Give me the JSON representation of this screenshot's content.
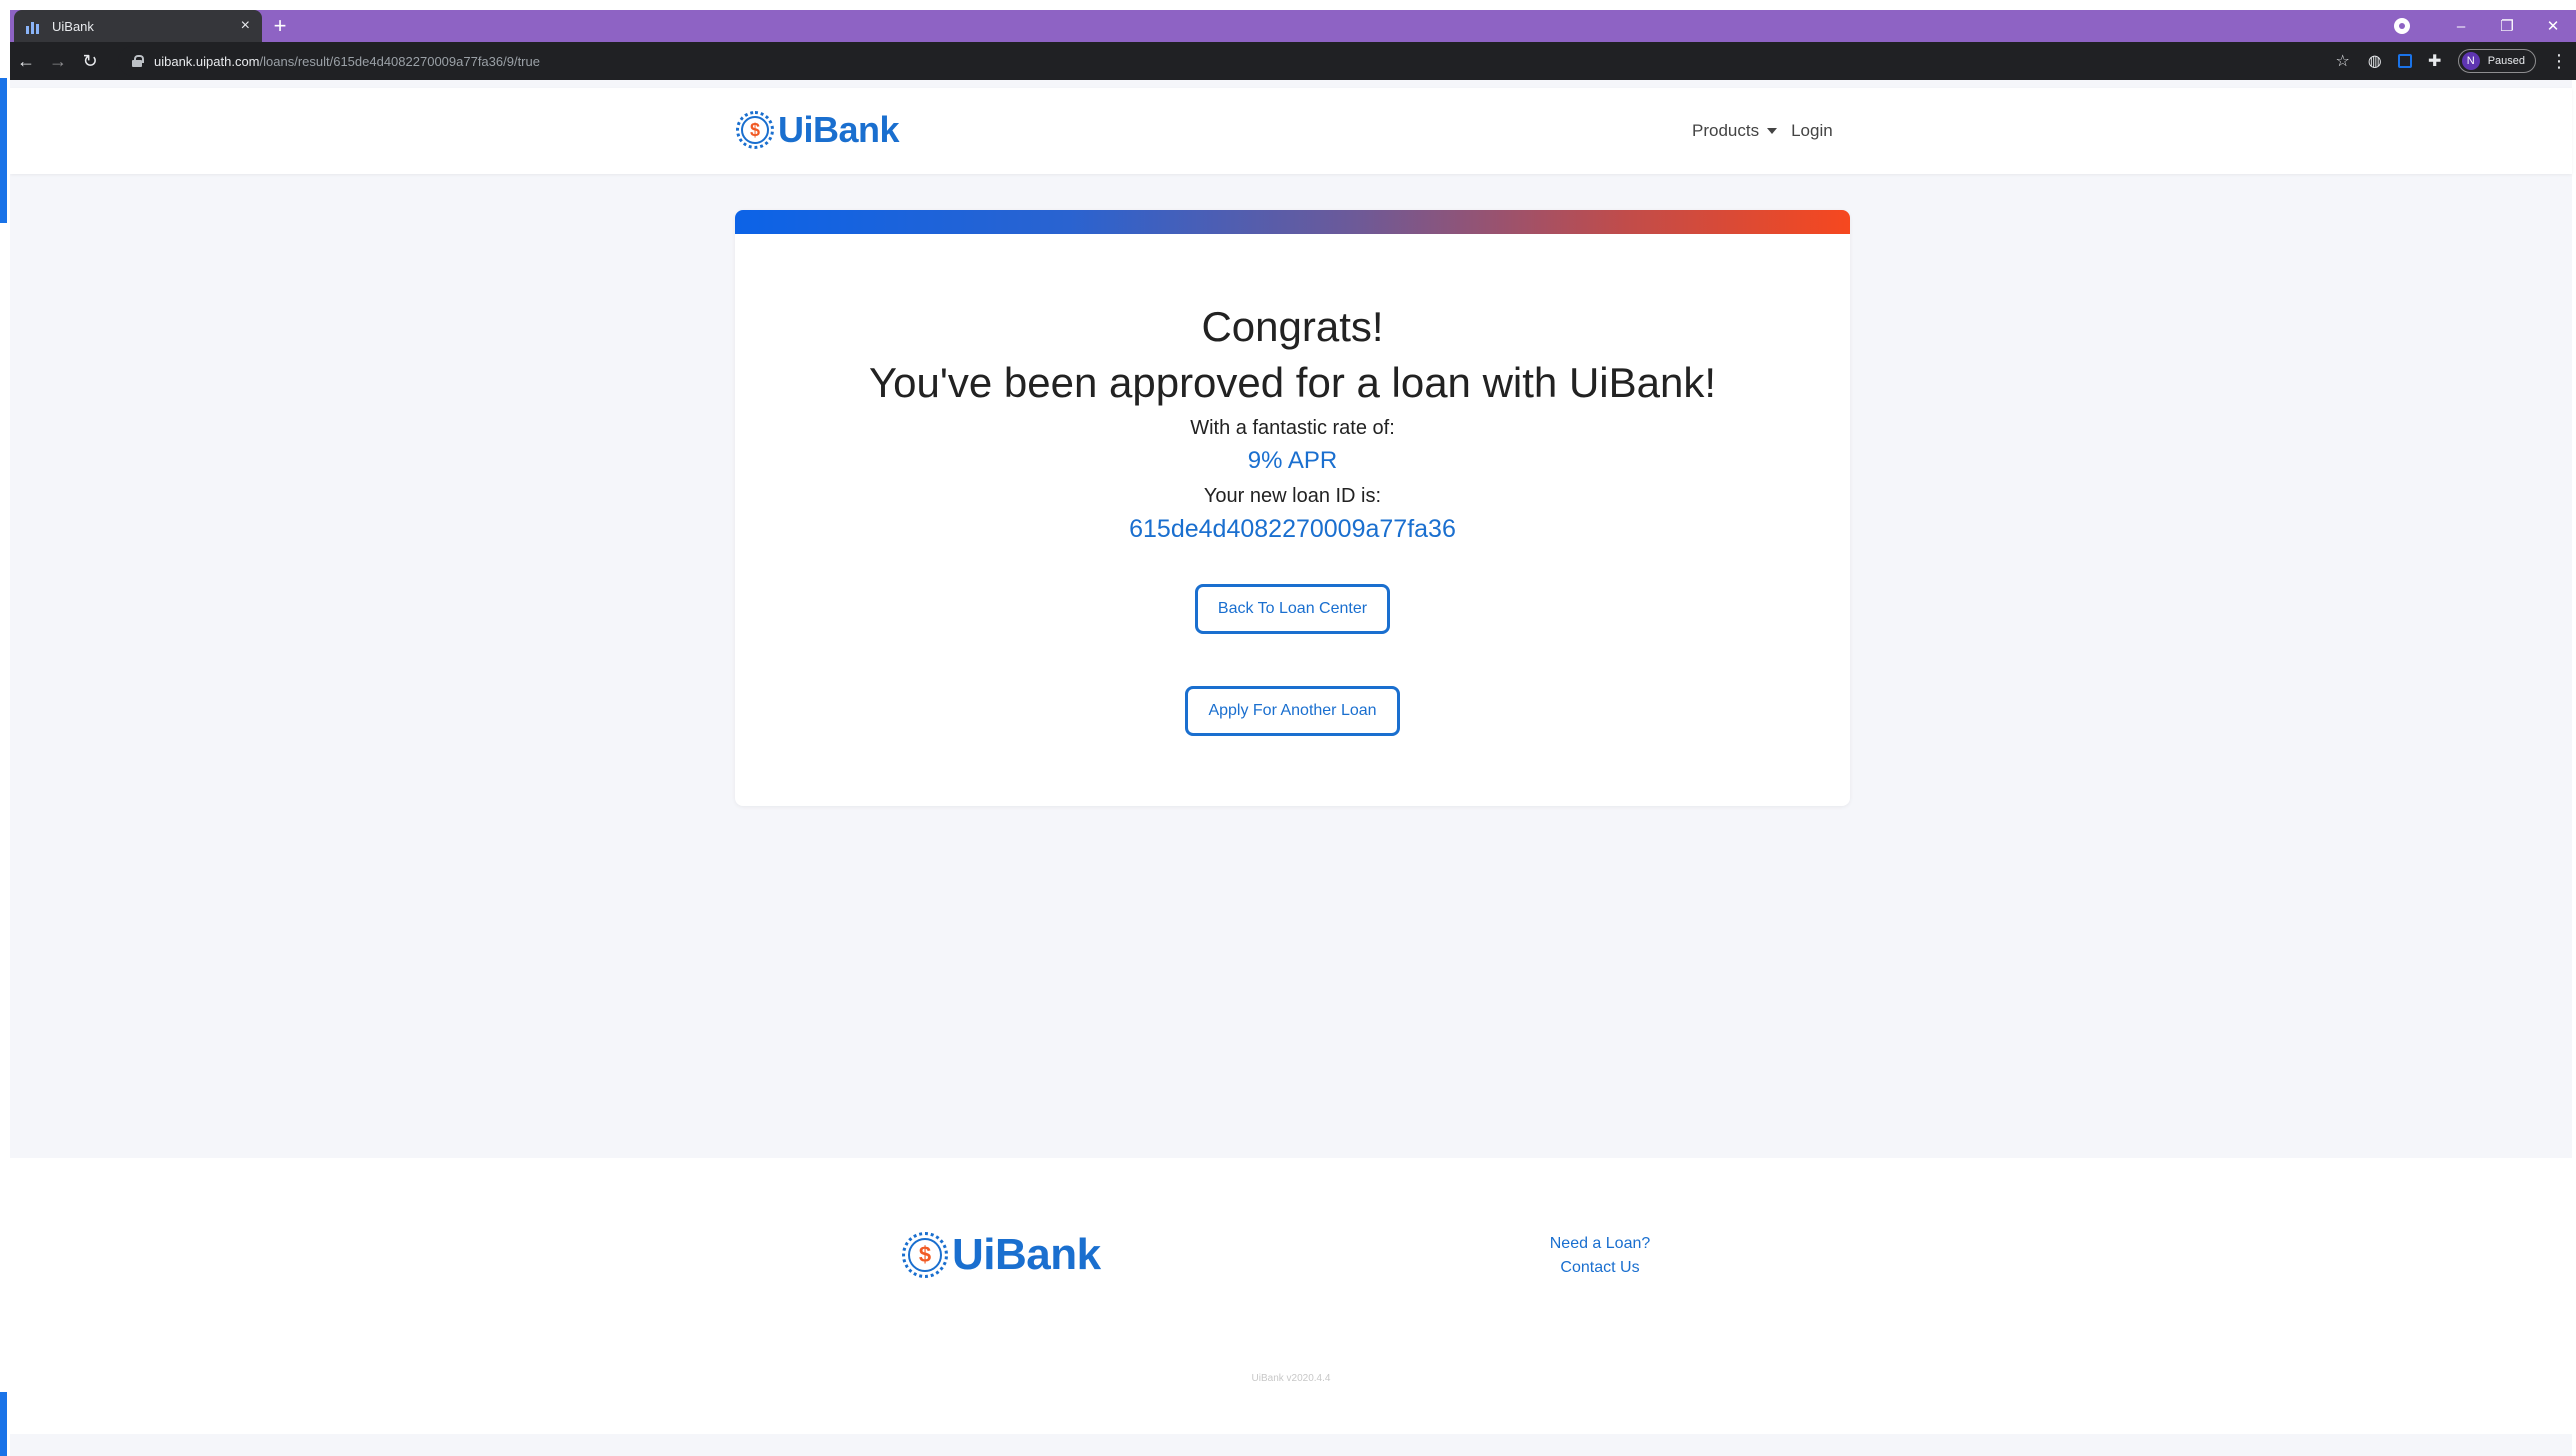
{
  "browser": {
    "tab_title": "UiBank",
    "tab_close": "×",
    "new_tab": "+",
    "url_host": "uibank.uipath.com",
    "url_path": "/loans/result/615de4d4082270009a77fa36/9/true",
    "profile_initial": "N",
    "profile_status": "Paused",
    "window_controls": {
      "minimize": "–",
      "restore": "❐",
      "close": "✕"
    },
    "nav": {
      "back": "←",
      "forward": "→",
      "reload": "↻"
    },
    "icons": {
      "star": "☆",
      "shield": "◍",
      "puzzle": "✚",
      "menu": "⋮"
    }
  },
  "navbar": {
    "brand": "UiBank",
    "coin_symbol": "$",
    "products_label": "Products",
    "login_label": "Login"
  },
  "result": {
    "headline": "Congrats!",
    "approved_message": "You've been approved for a loan with UiBank!",
    "rate_label": "With a fantastic rate of:",
    "rate_value": "9% APR",
    "loan_id_label": "Your new loan ID is:",
    "loan_id_value": "615de4d4082270009a77fa36",
    "back_button": "Back To Loan Center",
    "apply_button": "Apply For Another Loan"
  },
  "footer": {
    "brand": "UiBank",
    "coin_symbol": "$",
    "need_loan_link": "Need a Loan?",
    "contact_link": "Contact Us",
    "version": "UiBank v2020.4.4"
  },
  "colors": {
    "brand_blue": "#1a6fcf",
    "coin_orange": "#f15a24",
    "tabbar_purple": "#8e63c4",
    "gradient_start": "#0c63e7",
    "gradient_end": "#f6481f"
  }
}
